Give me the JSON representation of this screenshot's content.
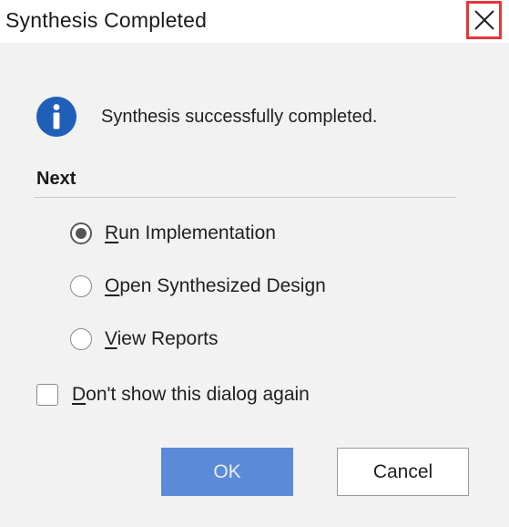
{
  "window": {
    "title": "Synthesis Completed",
    "close_icon": "close-icon",
    "close_highlight_color": "#e8343b"
  },
  "message": {
    "icon": "info-icon",
    "icon_color": "#1f5fb8",
    "text": "Synthesis successfully completed."
  },
  "next_section": {
    "heading": "Next",
    "options": [
      {
        "mnemonic": "R",
        "rest": "un Implementation",
        "checked": true
      },
      {
        "mnemonic": "O",
        "rest": "pen Synthesized Design",
        "checked": false
      },
      {
        "mnemonic": "V",
        "rest": "iew Reports",
        "checked": false
      }
    ]
  },
  "dont_show": {
    "mnemonic": "D",
    "rest": "on't show this dialog again",
    "checked": false
  },
  "buttons": {
    "ok_label": "OK",
    "cancel_label": "Cancel",
    "ok_color": "#5b8ad9"
  }
}
